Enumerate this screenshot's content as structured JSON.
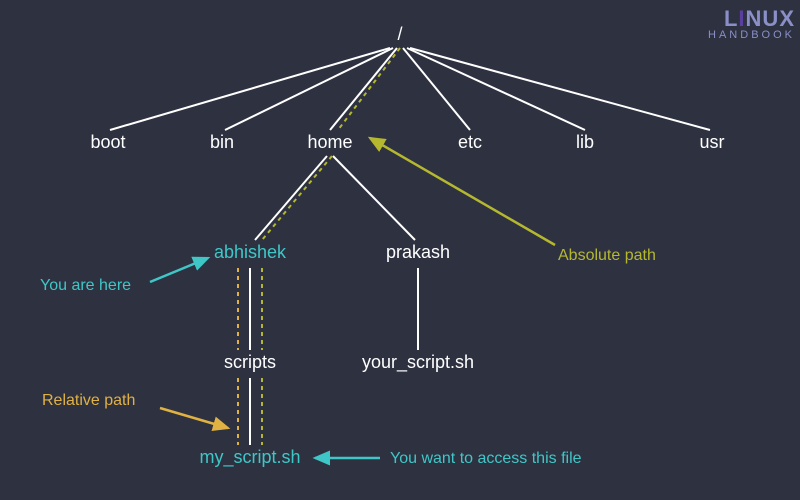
{
  "logo": {
    "line1a": "L",
    "line1b": "I",
    "line1c": "NUX",
    "line2": "HANDBOOK"
  },
  "tree": {
    "root": "/",
    "top": {
      "boot": "boot",
      "bin": "bin",
      "home": "home",
      "etc": "etc",
      "lib": "lib",
      "usr": "usr"
    },
    "home": {
      "abhishek": "abhishek",
      "prakash": "prakash"
    },
    "scripts": "scripts",
    "my_script": "my_script.sh",
    "your_script": "your_script.sh"
  },
  "annotations": {
    "you_are_here": "You are here",
    "absolute_path": "Absolute path",
    "relative_path": "Relative path",
    "want_access": "You want to access this file"
  },
  "colors": {
    "cyan": "#3fc7c7",
    "olive": "#b5b82f",
    "gold": "#e0b143",
    "white": "#ffffff",
    "bg": "#2e3140"
  }
}
